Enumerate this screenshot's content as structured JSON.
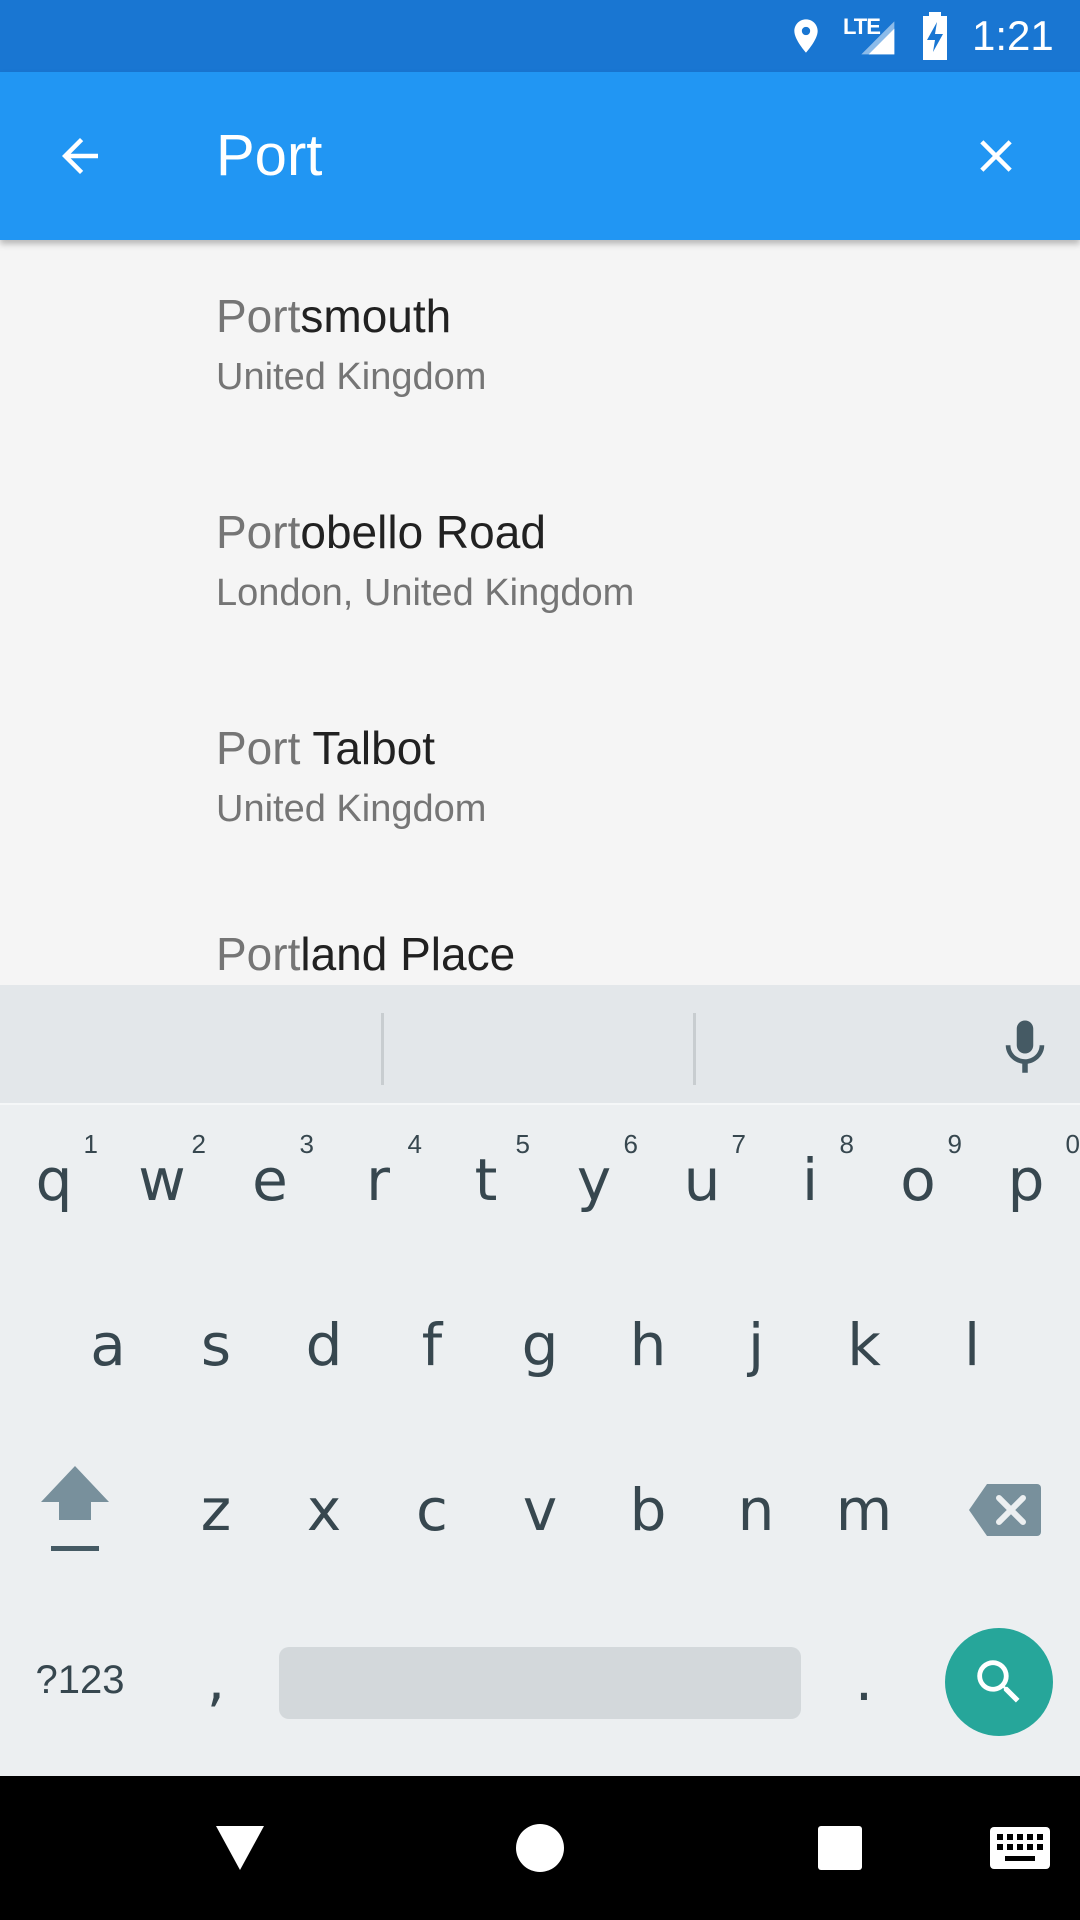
{
  "status_bar": {
    "network_label": "LTE",
    "time": "1:21"
  },
  "search": {
    "query": "Port",
    "back_icon": "arrow-left-icon",
    "clear_icon": "close-icon"
  },
  "results": [
    {
      "match": "Port",
      "rest": "smouth",
      "subtitle": "United Kingdom"
    },
    {
      "match": "Port",
      "rest": "obello Road",
      "subtitle": "London, United Kingdom"
    },
    {
      "match": "Port",
      "rest": " Talbot",
      "subtitle": "United Kingdom"
    },
    {
      "match": "Port",
      "rest": "land Place",
      "subtitle": ""
    }
  ],
  "keyboard": {
    "row1": [
      {
        "key": "q",
        "hint": "1"
      },
      {
        "key": "w",
        "hint": "2"
      },
      {
        "key": "e",
        "hint": "3"
      },
      {
        "key": "r",
        "hint": "4"
      },
      {
        "key": "t",
        "hint": "5"
      },
      {
        "key": "y",
        "hint": "6"
      },
      {
        "key": "u",
        "hint": "7"
      },
      {
        "key": "i",
        "hint": "8"
      },
      {
        "key": "o",
        "hint": "9"
      },
      {
        "key": "p",
        "hint": "0"
      }
    ],
    "row2": [
      "a",
      "s",
      "d",
      "f",
      "g",
      "h",
      "j",
      "k",
      "l"
    ],
    "row3": [
      "z",
      "x",
      "c",
      "v",
      "b",
      "n",
      "m"
    ],
    "symbols_label": "?123",
    "comma": ",",
    "period": ".",
    "accent_color": "#26a69a"
  },
  "colors": {
    "status_bar": "#1976d2",
    "toolbar": "#2196f3"
  }
}
